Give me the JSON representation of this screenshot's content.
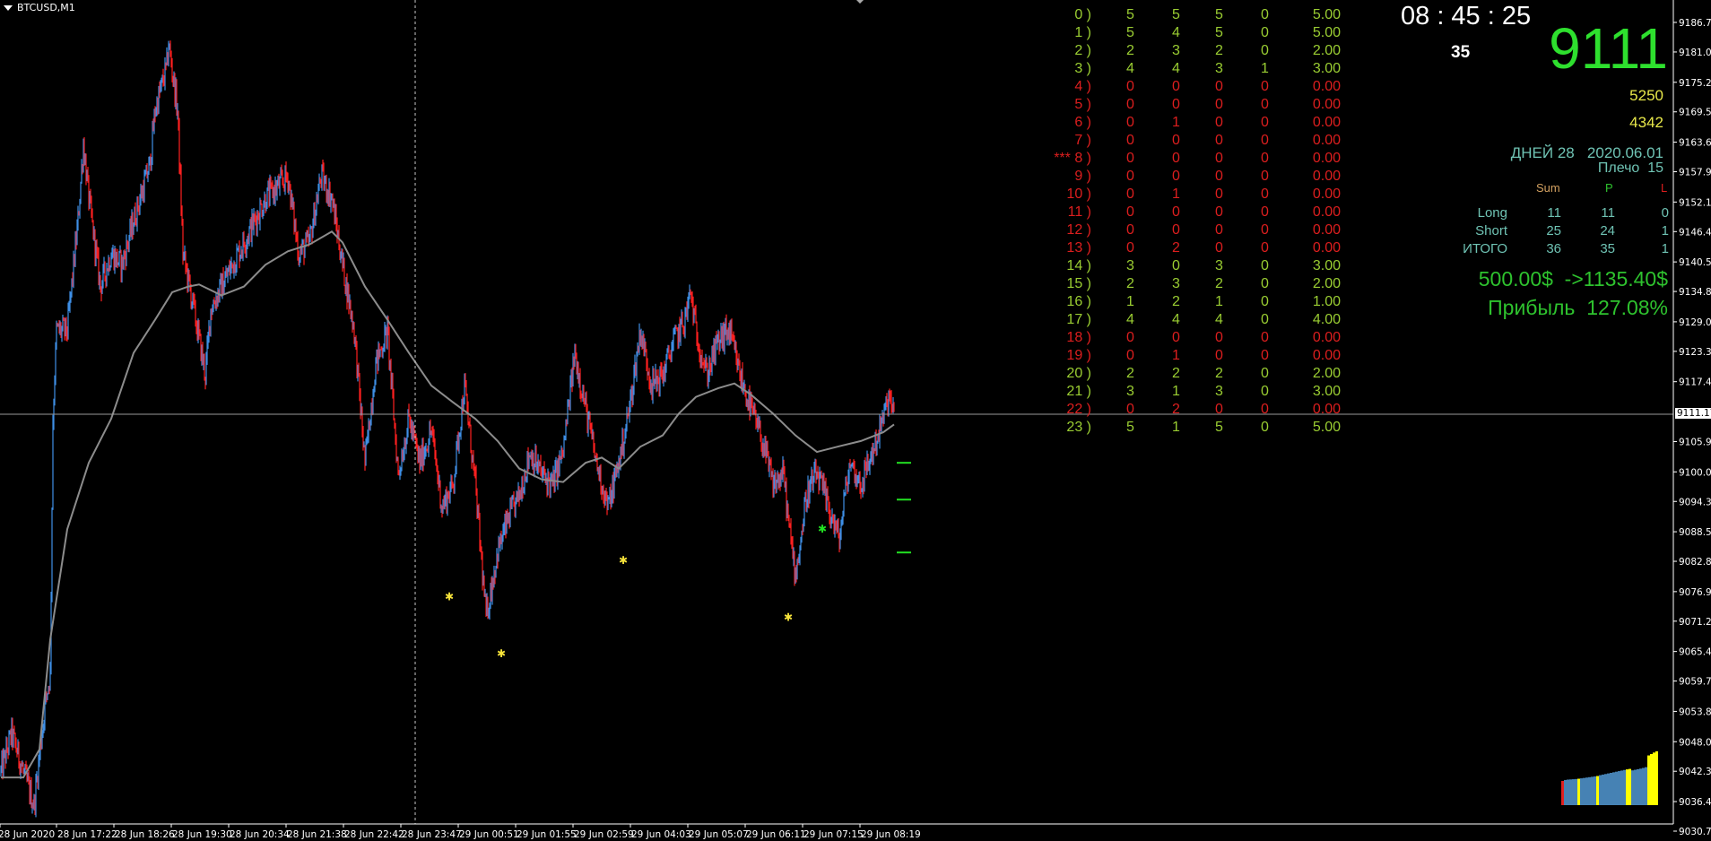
{
  "window": {
    "symbol_title": "BTCUSD,M1"
  },
  "hour_table": {
    "rows": [
      {
        "hour": "0 )",
        "c1": "5",
        "c2": "5",
        "c3": "5",
        "c4": "0",
        "val": "5.00",
        "status": "green"
      },
      {
        "hour": "1 )",
        "c1": "5",
        "c2": "4",
        "c3": "5",
        "c4": "0",
        "val": "5.00",
        "status": "green"
      },
      {
        "hour": "2 )",
        "c1": "2",
        "c2": "3",
        "c3": "2",
        "c4": "0",
        "val": "2.00",
        "status": "green"
      },
      {
        "hour": "3 )",
        "c1": "4",
        "c2": "4",
        "c3": "3",
        "c4": "1",
        "val": "3.00",
        "status": "green"
      },
      {
        "hour": "4 )",
        "c1": "0",
        "c2": "0",
        "c3": "0",
        "c4": "0",
        "val": "0.00",
        "status": "red"
      },
      {
        "hour": "5 )",
        "c1": "0",
        "c2": "0",
        "c3": "0",
        "c4": "0",
        "val": "0.00",
        "status": "red"
      },
      {
        "hour": "6 )",
        "c1": "0",
        "c2": "1",
        "c3": "0",
        "c4": "0",
        "val": "0.00",
        "status": "red"
      },
      {
        "hour": "7 )",
        "c1": "0",
        "c2": "0",
        "c3": "0",
        "c4": "0",
        "val": "0.00",
        "status": "red"
      },
      {
        "hour": "*** 8 )",
        "c1": "0",
        "c2": "0",
        "c3": "0",
        "c4": "0",
        "val": "0.00",
        "status": "red"
      },
      {
        "hour": "9 )",
        "c1": "0",
        "c2": "0",
        "c3": "0",
        "c4": "0",
        "val": "0.00",
        "status": "red"
      },
      {
        "hour": "10 )",
        "c1": "0",
        "c2": "1",
        "c3": "0",
        "c4": "0",
        "val": "0.00",
        "status": "red"
      },
      {
        "hour": "11 )",
        "c1": "0",
        "c2": "0",
        "c3": "0",
        "c4": "0",
        "val": "0.00",
        "status": "red"
      },
      {
        "hour": "12 )",
        "c1": "0",
        "c2": "0",
        "c3": "0",
        "c4": "0",
        "val": "0.00",
        "status": "red"
      },
      {
        "hour": "13 )",
        "c1": "0",
        "c2": "2",
        "c3": "0",
        "c4": "0",
        "val": "0.00",
        "status": "red"
      },
      {
        "hour": "14 )",
        "c1": "3",
        "c2": "0",
        "c3": "3",
        "c4": "0",
        "val": "3.00",
        "status": "green"
      },
      {
        "hour": "15 )",
        "c1": "2",
        "c2": "3",
        "c3": "2",
        "c4": "0",
        "val": "2.00",
        "status": "green"
      },
      {
        "hour": "16 )",
        "c1": "1",
        "c2": "2",
        "c3": "1",
        "c4": "0",
        "val": "1.00",
        "status": "green"
      },
      {
        "hour": "17 )",
        "c1": "4",
        "c2": "4",
        "c3": "4",
        "c4": "0",
        "val": "4.00",
        "status": "green"
      },
      {
        "hour": "18 )",
        "c1": "0",
        "c2": "0",
        "c3": "0",
        "c4": "0",
        "val": "0.00",
        "status": "red"
      },
      {
        "hour": "19 )",
        "c1": "0",
        "c2": "1",
        "c3": "0",
        "c4": "0",
        "val": "0.00",
        "status": "red"
      },
      {
        "hour": "20 )",
        "c1": "2",
        "c2": "2",
        "c3": "2",
        "c4": "0",
        "val": "2.00",
        "status": "green"
      },
      {
        "hour": "21 )",
        "c1": "3",
        "c2": "1",
        "c3": "3",
        "c4": "0",
        "val": "3.00",
        "status": "green"
      },
      {
        "hour": "22 )",
        "c1": "0",
        "c2": "2",
        "c3": "0",
        "c4": "0",
        "val": "0.00",
        "status": "red"
      },
      {
        "hour": "23 )",
        "c1": "5",
        "c2": "1",
        "c3": "5",
        "c4": "0",
        "val": "5.00",
        "status": "green"
      }
    ]
  },
  "info_panel": {
    "clock": "08 : 45 : 25",
    "seconds_left": "35",
    "big_price": "9111",
    "value_a": "5250",
    "value_b": "4342",
    "days": "ДНЕЙ 28   2020.06.01",
    "leverage": "Плечо  15",
    "stats_headers": {
      "sum": "Sum",
      "p": "P",
      "l": "L"
    },
    "stats_rows": [
      {
        "label": "Long",
        "sum": "11",
        "p": "11",
        "l": "0"
      },
      {
        "label": "Short",
        "sum": "25",
        "p": "24",
        "l": "1"
      },
      {
        "label": "ИТОГО",
        "sum": "36",
        "p": "35",
        "l": "1"
      }
    ],
    "balance": "500.00$  ->1135.40$",
    "profit": "Прибыль  127.08%"
  },
  "colors": {
    "green": "#9acd32",
    "red": "#dc1e1e",
    "teal": "#6fc3b4",
    "bull": "#3f8fe6",
    "bear": "#ff2020",
    "ma": "#8c8c8c",
    "big": "#2ee02e",
    "yellow": "#e8e84a"
  },
  "chart_data": {
    "type": "candlestick",
    "symbol": "BTCUSD",
    "timeframe": "M1",
    "current_price": 9111.17,
    "current_price_label": "9111.17",
    "ylim": [
      9027.0,
      9191.0
    ],
    "price_ticks": [
      "9186.75",
      "9181.05",
      "9175.20",
      "9169.50",
      "9163.65",
      "9157.95",
      "9152.10",
      "9146.40",
      "9140.55",
      "9134.85",
      "9129.00",
      "9123.30",
      "9117.45",
      "9105.90",
      "9100.05",
      "9094.35",
      "9088.50",
      "9082.80",
      "9076.95",
      "9071.25",
      "9065.40",
      "9059.70",
      "9053.85",
      "9048.00",
      "9042.30",
      "9036.45",
      "9030.75"
    ],
    "time_ticks": [
      "28 Jun 2020",
      "28 Jun 17:22",
      "28 Jun 18:26",
      "28 Jun 19:30",
      "28 Jun 20:34",
      "28 Jun 21:38",
      "28 Jun 22:42",
      "28 Jun 23:47",
      "29 Jun 00:51",
      "29 Jun 01:55",
      "29 Jun 02:59",
      "29 Jun 04:03",
      "29 Jun 05:07",
      "29 Jun 06:11",
      "29 Jun 07:15",
      "29 Jun 08:19"
    ],
    "price_path_minute_price": [
      [
        0,
        9042.2
      ],
      [
        12,
        9049.6
      ],
      [
        25,
        9042.2
      ],
      [
        37,
        9035.8
      ],
      [
        49,
        9054.9
      ],
      [
        55,
        9061.3
      ],
      [
        58,
        9110.3
      ],
      [
        62,
        9127.3
      ],
      [
        74,
        9127.3
      ],
      [
        86,
        9148.5
      ],
      [
        92,
        9163.4
      ],
      [
        98,
        9152.8
      ],
      [
        111,
        9135.8
      ],
      [
        123,
        9142.2
      ],
      [
        135,
        9140.0
      ],
      [
        148,
        9148.5
      ],
      [
        166,
        9159.2
      ],
      [
        172,
        9169.8
      ],
      [
        185,
        9178.3
      ],
      [
        187,
        9182.6
      ],
      [
        197,
        9169.8
      ],
      [
        203,
        9142.2
      ],
      [
        215,
        9131.5
      ],
      [
        228,
        9118.8
      ],
      [
        234,
        9131.5
      ],
      [
        246,
        9135.8
      ],
      [
        258,
        9140.0
      ],
      [
        271,
        9144.3
      ],
      [
        283,
        9148.5
      ],
      [
        295,
        9152.8
      ],
      [
        308,
        9154.9
      ],
      [
        320,
        9157.1
      ],
      [
        332,
        9142.2
      ],
      [
        344,
        9144.3
      ],
      [
        357,
        9157.1
      ],
      [
        369,
        9152.8
      ],
      [
        381,
        9140.0
      ],
      [
        394,
        9127.3
      ],
      [
        406,
        9101.8
      ],
      [
        418,
        9120.9
      ],
      [
        431,
        9127.3
      ],
      [
        443,
        9099.6
      ],
      [
        455,
        9110.3
      ],
      [
        467,
        9101.8
      ],
      [
        480,
        9108.1
      ],
      [
        492,
        9093.2
      ],
      [
        504,
        9097.5
      ],
      [
        517,
        9116.7
      ],
      [
        529,
        9097.5
      ],
      [
        541,
        9072.0
      ],
      [
        554,
        9084.7
      ],
      [
        566,
        9091.1
      ],
      [
        578,
        9095.4
      ],
      [
        590,
        9103.9
      ],
      [
        603,
        9099.6
      ],
      [
        615,
        9097.5
      ],
      [
        627,
        9103.9
      ],
      [
        640,
        9123.0
      ],
      [
        652,
        9112.4
      ],
      [
        664,
        9101.8
      ],
      [
        677,
        9093.2
      ],
      [
        689,
        9101.8
      ],
      [
        701,
        9112.4
      ],
      [
        713,
        9127.3
      ],
      [
        726,
        9116.7
      ],
      [
        738,
        9118.8
      ],
      [
        750,
        9125.2
      ],
      [
        763,
        9129.4
      ],
      [
        769,
        9134.7
      ],
      [
        775,
        9127.3
      ],
      [
        787,
        9118.8
      ],
      [
        800,
        9125.2
      ],
      [
        812,
        9127.3
      ],
      [
        824,
        9118.8
      ],
      [
        836,
        9112.4
      ],
      [
        849,
        9106.0
      ],
      [
        861,
        9097.5
      ],
      [
        873,
        9099.6
      ],
      [
        879,
        9089.0
      ],
      [
        886,
        9080.5
      ],
      [
        892,
        9086.9
      ],
      [
        898,
        9095.4
      ],
      [
        910,
        9099.6
      ],
      [
        923,
        9093.2
      ],
      [
        935,
        9086.9
      ],
      [
        941,
        9095.4
      ],
      [
        947,
        9101.8
      ],
      [
        959,
        9097.5
      ],
      [
        972,
        9103.9
      ],
      [
        984,
        9110.3
      ],
      [
        990,
        9114.5
      ],
      [
        996,
        9111.2
      ]
    ],
    "moving_average": [
      [
        0,
        9041.1
      ],
      [
        25,
        9041.1
      ],
      [
        43,
        9046.5
      ],
      [
        55,
        9067.7
      ],
      [
        74,
        9089.0
      ],
      [
        98,
        9101.8
      ],
      [
        123,
        9110.3
      ],
      [
        148,
        9123.0
      ],
      [
        172,
        9129.4
      ],
      [
        191,
        9134.7
      ],
      [
        209,
        9135.8
      ],
      [
        221,
        9136.2
      ],
      [
        246,
        9134.1
      ],
      [
        271,
        9135.8
      ],
      [
        295,
        9140.0
      ],
      [
        320,
        9142.6
      ],
      [
        344,
        9143.9
      ],
      [
        369,
        9146.4
      ],
      [
        381,
        9144.3
      ],
      [
        406,
        9135.8
      ],
      [
        431,
        9129.4
      ],
      [
        455,
        9123.0
      ],
      [
        480,
        9116.7
      ],
      [
        504,
        9113.5
      ],
      [
        529,
        9110.3
      ],
      [
        554,
        9106.0
      ],
      [
        578,
        9100.7
      ],
      [
        603,
        9098.6
      ],
      [
        627,
        9098.1
      ],
      [
        652,
        9101.8
      ],
      [
        670,
        9102.8
      ],
      [
        689,
        9100.7
      ],
      [
        713,
        9104.9
      ],
      [
        738,
        9107.1
      ],
      [
        756,
        9111.3
      ],
      [
        775,
        9114.5
      ],
      [
        800,
        9116.2
      ],
      [
        818,
        9117.1
      ],
      [
        836,
        9115.0
      ],
      [
        861,
        9111.3
      ],
      [
        886,
        9107.1
      ],
      [
        910,
        9103.9
      ],
      [
        935,
        9105.0
      ],
      [
        959,
        9106.0
      ],
      [
        984,
        9107.7
      ],
      [
        996,
        9109.2
      ]
    ],
    "markers": [
      {
        "minute": 500,
        "price": 9076.0,
        "color": "yellow"
      },
      {
        "minute": 558,
        "price": 9065.0,
        "color": "yellow"
      },
      {
        "minute": 694,
        "price": 9083.0,
        "color": "yellow"
      },
      {
        "minute": 878,
        "price": 9072.0,
        "color": "yellow"
      },
      {
        "minute": 916,
        "price": 9089.0,
        "color": "green"
      }
    ],
    "levels": [
      9101.8,
      9094.7,
      9084.5
    ],
    "equity_bars": {
      "values": [
        520,
        540,
        548,
        552,
        556,
        560,
        566,
        574,
        582,
        590,
        598,
        606,
        614,
        622,
        640,
        652,
        664,
        676,
        688,
        700,
        712,
        724,
        736,
        748,
        760,
        770,
        740,
        752,
        764,
        776,
        790,
        806,
        1050,
        1080,
        1110,
        1135
      ],
      "colors": [
        "red",
        "blue",
        "blue",
        "blue",
        "blue",
        "blue",
        "yellow",
        "blue",
        "blue",
        "blue",
        "blue",
        "blue",
        "blue",
        "yellow",
        "blue",
        "blue",
        "blue",
        "blue",
        "blue",
        "blue",
        "blue",
        "blue",
        "blue",
        "blue",
        "yellow",
        "yellow",
        "blue",
        "blue",
        "blue",
        "blue",
        "blue",
        "blue",
        "yellow",
        "yellow",
        "yellow",
        "yellow"
      ]
    }
  }
}
